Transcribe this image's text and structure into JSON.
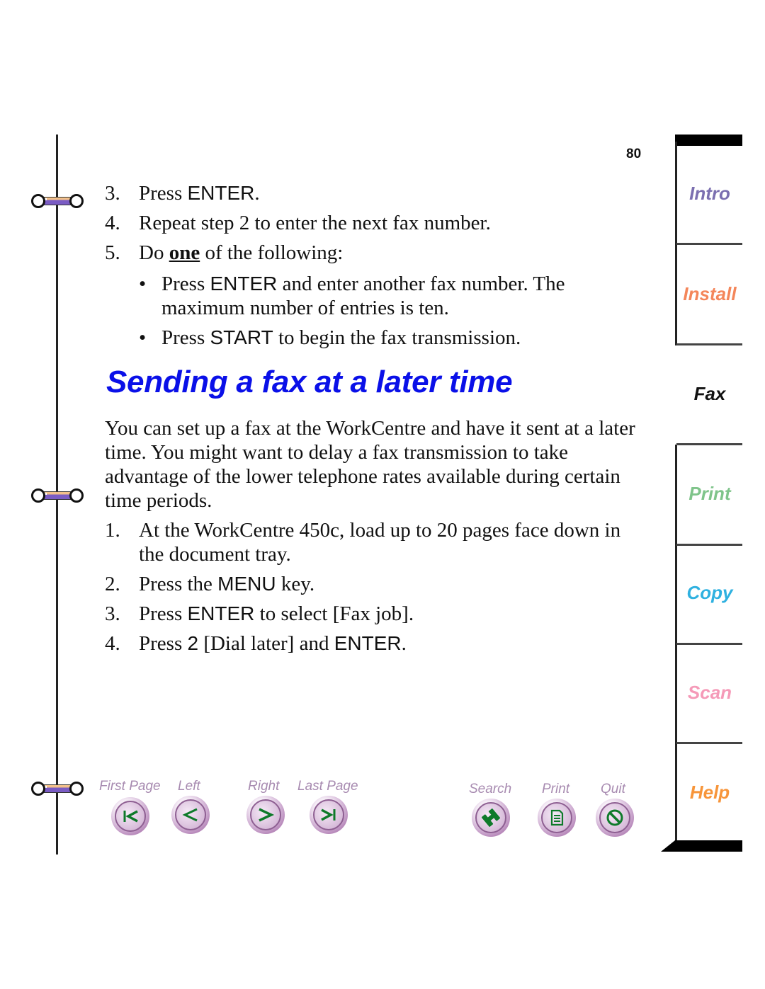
{
  "page_number": "80",
  "top_steps": [
    {
      "num": "3.",
      "parts": [
        {
          "t": "Press ",
          "style": "serif"
        },
        {
          "t": "ENTER",
          "style": "sans"
        },
        {
          "t": ".",
          "style": "serif"
        }
      ]
    },
    {
      "num": "4.",
      "parts": [
        {
          "t": "Repeat step 2 to enter the next fax number.",
          "style": "serif"
        }
      ]
    },
    {
      "num": "5.",
      "parts": [
        {
          "t": "Do ",
          "style": "serif"
        },
        {
          "t": "one",
          "style": "underline"
        },
        {
          "t": " of the following:",
          "style": "serif"
        }
      ]
    }
  ],
  "bullets": [
    {
      "parts": [
        {
          "t": "Press ",
          "style": "serif"
        },
        {
          "t": "ENTER",
          "style": "sans"
        },
        {
          "t": " and enter another fax number. The maximum number of entries is ten.",
          "style": "serif"
        }
      ]
    },
    {
      "parts": [
        {
          "t": "Press ",
          "style": "serif"
        },
        {
          "t": "START",
          "style": "sans"
        },
        {
          "t": " to begin the fax transmission.",
          "style": "serif"
        }
      ]
    }
  ],
  "heading": "Sending a fax at a later time",
  "intro": "You can set up a fax at the WorkCentre and have it sent at a later time. You might want to delay a fax transmission to take advantage of the lower telephone rates available during certain time periods.",
  "steps": [
    {
      "num": "1.",
      "parts": [
        {
          "t": "At the WorkCentre 450c, load up to 20 pages face down in the document tray.",
          "style": "serif"
        }
      ]
    },
    {
      "num": "2.",
      "parts": [
        {
          "t": "Press the ",
          "style": "serif"
        },
        {
          "t": "MENU",
          "style": "sans"
        },
        {
          "t": " key.",
          "style": "serif"
        }
      ]
    },
    {
      "num": "3.",
      "parts": [
        {
          "t": "Press ",
          "style": "serif"
        },
        {
          "t": "ENTER",
          "style": "sans"
        },
        {
          "t": " to select [Fax job].",
          "style": "serif"
        }
      ]
    },
    {
      "num": "4.",
      "parts": [
        {
          "t": "Press ",
          "style": "serif"
        },
        {
          "t": "2",
          "style": "sans"
        },
        {
          "t": " [Dial later] and ",
          "style": "serif"
        },
        {
          "t": "ENTER",
          "style": "sans"
        },
        {
          "t": ".",
          "style": "serif"
        }
      ]
    }
  ],
  "nav": {
    "first_page": "First Page",
    "left": "Left",
    "right": "Right",
    "last_page": "Last Page",
    "search": "Search",
    "print": "Print",
    "quit": "Quit"
  },
  "tabs": [
    {
      "label": "Intro",
      "color": "#7b6fb0"
    },
    {
      "label": "Install",
      "color": "#f4865a"
    },
    {
      "label": "Fax",
      "color": "#111111",
      "active": true
    },
    {
      "label": "Print",
      "color": "#7fc48a"
    },
    {
      "label": "Copy",
      "color": "#2fb1e0"
    },
    {
      "label": "Scan",
      "color": "#f59ab8"
    },
    {
      "label": "Help",
      "color": "#f7953a"
    }
  ],
  "colors": {
    "heading": "#0a10e8",
    "nav_label": "#a78ab0",
    "nav_icon": "#0e7a2a"
  }
}
